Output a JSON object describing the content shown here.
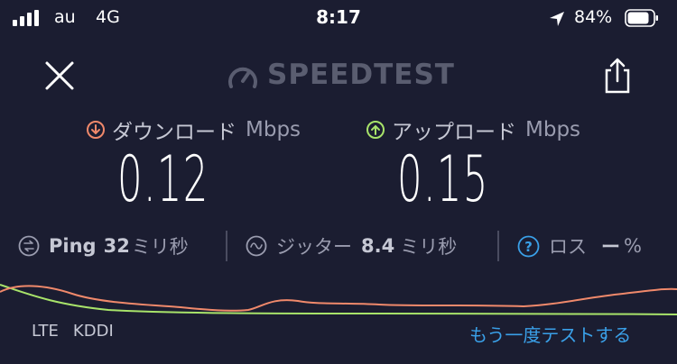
{
  "status_bar": {
    "carrier": "au",
    "network": "4G",
    "time": "8:17",
    "battery": "84%",
    "battery_level": 0.84
  },
  "header": {
    "logo": "SPEEDTEST",
    "close_icon": "close-icon",
    "share_icon": "share-icon"
  },
  "download": {
    "label": "ダウンロード",
    "unit": "Mbps",
    "value": "0.12",
    "color": "#f0896b"
  },
  "upload": {
    "label": "アップロード",
    "unit": "Mbps",
    "value": "0.15",
    "color": "#a8e36a"
  },
  "ping": {
    "label": "Ping",
    "value": "32",
    "unit": "ミリ秒"
  },
  "jitter": {
    "label": "ジッター",
    "value": "8.4",
    "unit": "ミリ秒"
  },
  "loss": {
    "label": "ロス",
    "value": "ー",
    "unit": "%"
  },
  "footer": {
    "connection_type": "LTE",
    "provider": "KDDI",
    "retry_label": "もう一度テストする"
  },
  "colors": {
    "background": "#1b1d31",
    "link": "#3aa0e8"
  }
}
